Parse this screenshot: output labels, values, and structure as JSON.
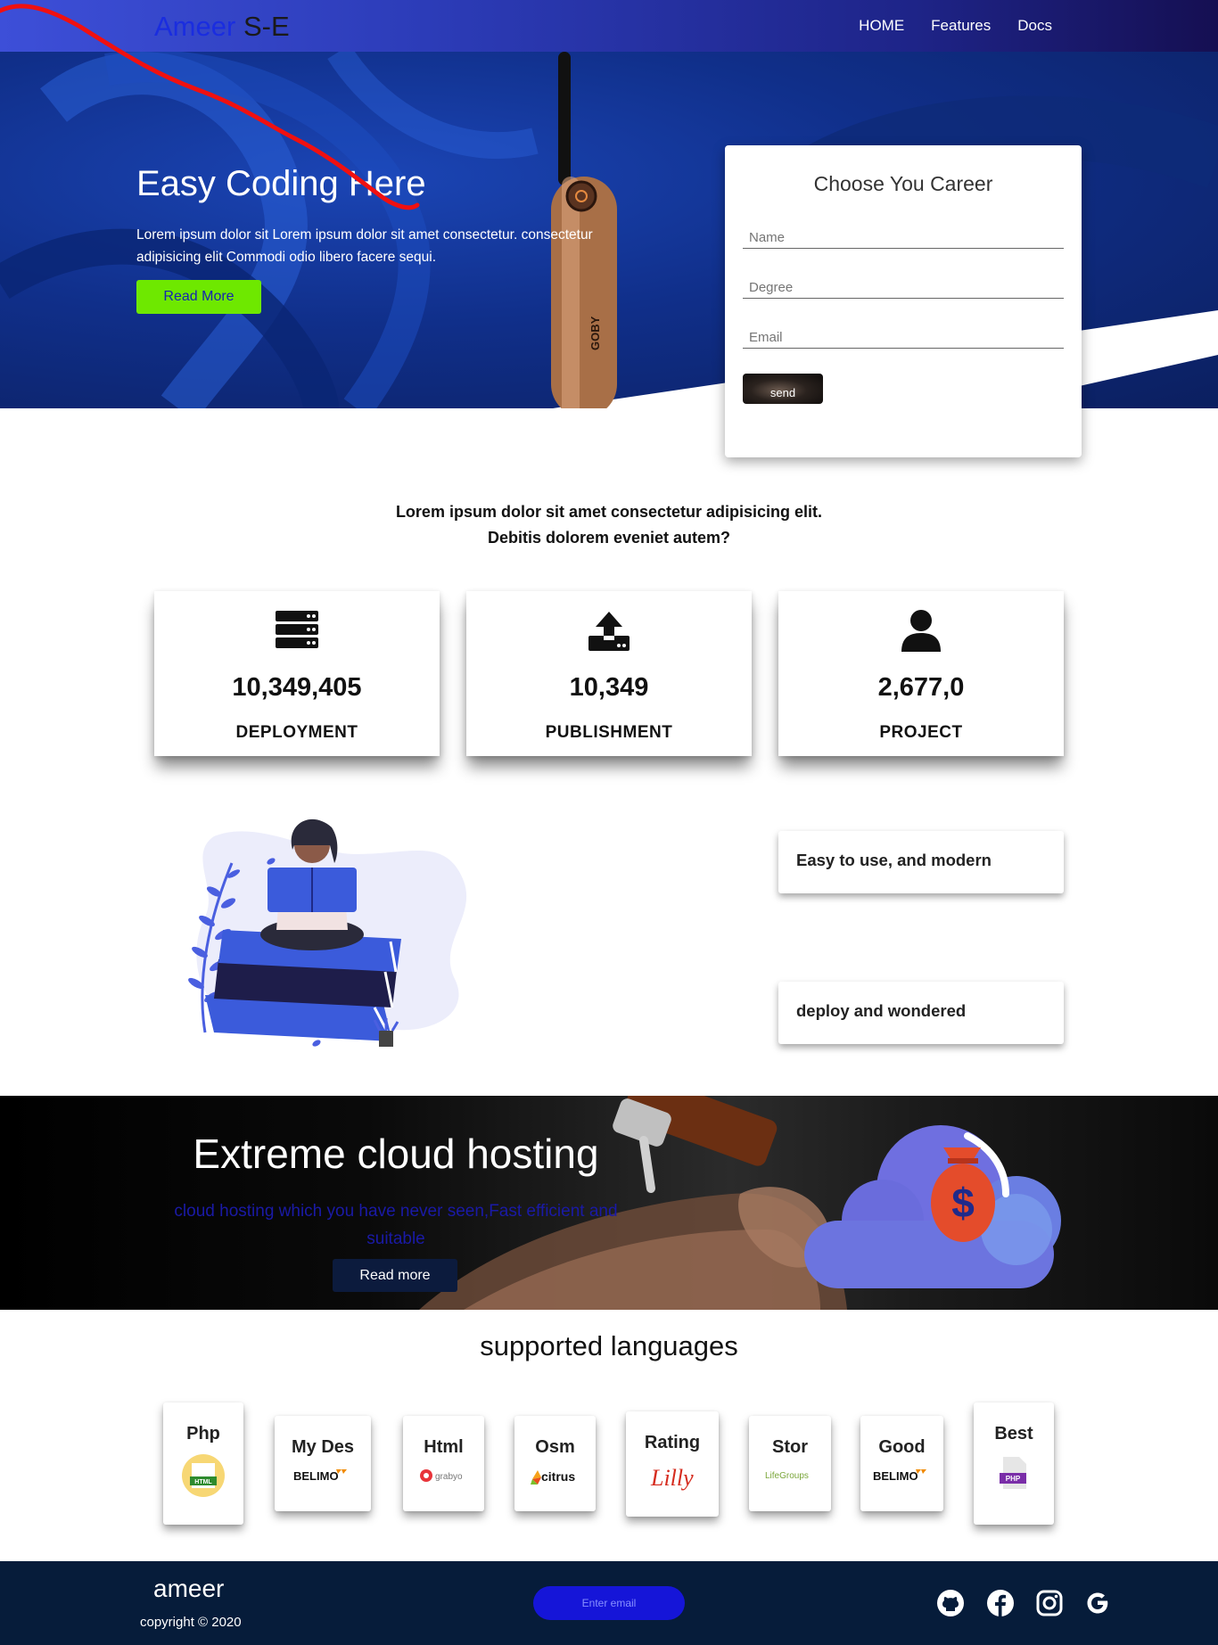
{
  "nav": {
    "brand_part1": "Ameer",
    "brand_part2": "S-E",
    "links": [
      "HOME",
      "Features",
      "Docs"
    ]
  },
  "hero": {
    "title": "Easy Coding Here",
    "text": "Lorem ipsum dolor sit Lorem ipsum dolor sit amet consectetur. consectetur adipisicing elit Commodi odio libero facere sequi.",
    "button": "Read More",
    "product_label": "GOBY"
  },
  "career_form": {
    "title": "Choose You Career",
    "name_placeholder": "Name",
    "degree_placeholder": "Degree",
    "email_placeholder": "Email",
    "send_label": "send"
  },
  "intro": {
    "line1": "Lorem ipsum dolor sit amet consectetur adipisicing elit.",
    "line2": "Debitis dolorem eveniet autem?"
  },
  "stats": [
    {
      "icon": "server-icon",
      "value": "10,349,405",
      "label": "DEPLOYMENT"
    },
    {
      "icon": "upload-icon",
      "value": "10,349",
      "label": "PUBLISHMENT"
    },
    {
      "icon": "user-icon",
      "value": "2,677,0",
      "label": "PROJECT"
    }
  ],
  "features": [
    "Easy to use, and modern",
    "deploy and wondered"
  ],
  "banner": {
    "title": "Extreme cloud hosting",
    "text": "cloud hosting which you have never seen,Fast efficient and suitable",
    "button": "Read more",
    "cloud_symbol": "$"
  },
  "languages": {
    "title": "supported languages",
    "items": [
      {
        "name": "Php",
        "logo": "HTML",
        "logo_style": "html-badge"
      },
      {
        "name": "My Des",
        "logo": "BELIMO",
        "logo_style": "belimo"
      },
      {
        "name": "Html",
        "logo": "grabyo",
        "logo_style": "grabyo"
      },
      {
        "name": "Osm",
        "logo": "citrus",
        "logo_style": "citrus"
      },
      {
        "name": "Rating",
        "logo": "Lilly",
        "logo_style": "lilly"
      },
      {
        "name": "Stor",
        "logo": "LifeGroups",
        "logo_style": "lifegroups"
      },
      {
        "name": "Good",
        "logo": "BELIMO",
        "logo_style": "belimo"
      },
      {
        "name": "Best",
        "logo": "PHP",
        "logo_style": "php-file"
      }
    ]
  },
  "footer": {
    "brand": "ameer",
    "copyright": "copyright © 2020",
    "email_placeholder": "Enter email",
    "social_icons": [
      "github-icon",
      "facebook-icon",
      "instagram-icon",
      "google-icon"
    ]
  },
  "colors": {
    "nav_gradient_start": "#3d4fd8",
    "nav_gradient_end": "#150f52",
    "hero_bg": "#102f8a",
    "hero_button": "#6ee800",
    "banner_button": "#0c1b3d",
    "footer_bg": "#061c3a",
    "footer_email_bg": "#1515d8",
    "cloud": "#6f6fe0",
    "money_bag": "#e44c2b"
  }
}
